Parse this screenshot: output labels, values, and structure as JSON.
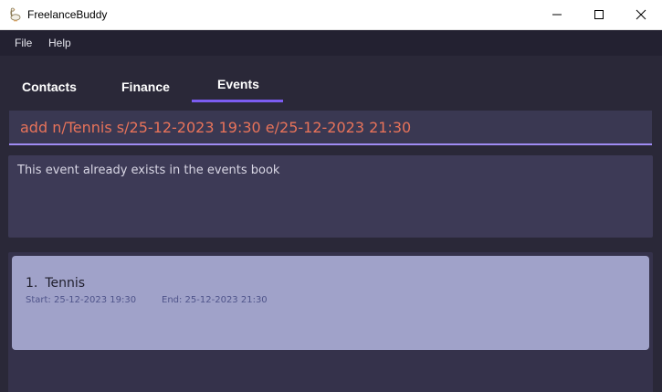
{
  "window": {
    "title": "FreelanceBuddy",
    "icon": "goose-icon"
  },
  "menu": {
    "file": "File",
    "help": "Help"
  },
  "tabs": [
    {
      "label": "Contacts",
      "active": false
    },
    {
      "label": "Finance",
      "active": false
    },
    {
      "label": "Events",
      "active": true
    }
  ],
  "command": {
    "value": "add n/Tennis s/25-12-2023 19:30 e/25-12-2023 21:30"
  },
  "result": {
    "message": "This event already exists in the events book"
  },
  "events": [
    {
      "index": "1.",
      "name": "Tennis",
      "start": "Start: 25-12-2023 19:30",
      "end": "End: 25-12-2023 21:30"
    }
  ],
  "colors": {
    "accent": "#7b5cf0",
    "command_text": "#e8735a",
    "card": "#a0a2c9",
    "background": "#2a2838"
  }
}
